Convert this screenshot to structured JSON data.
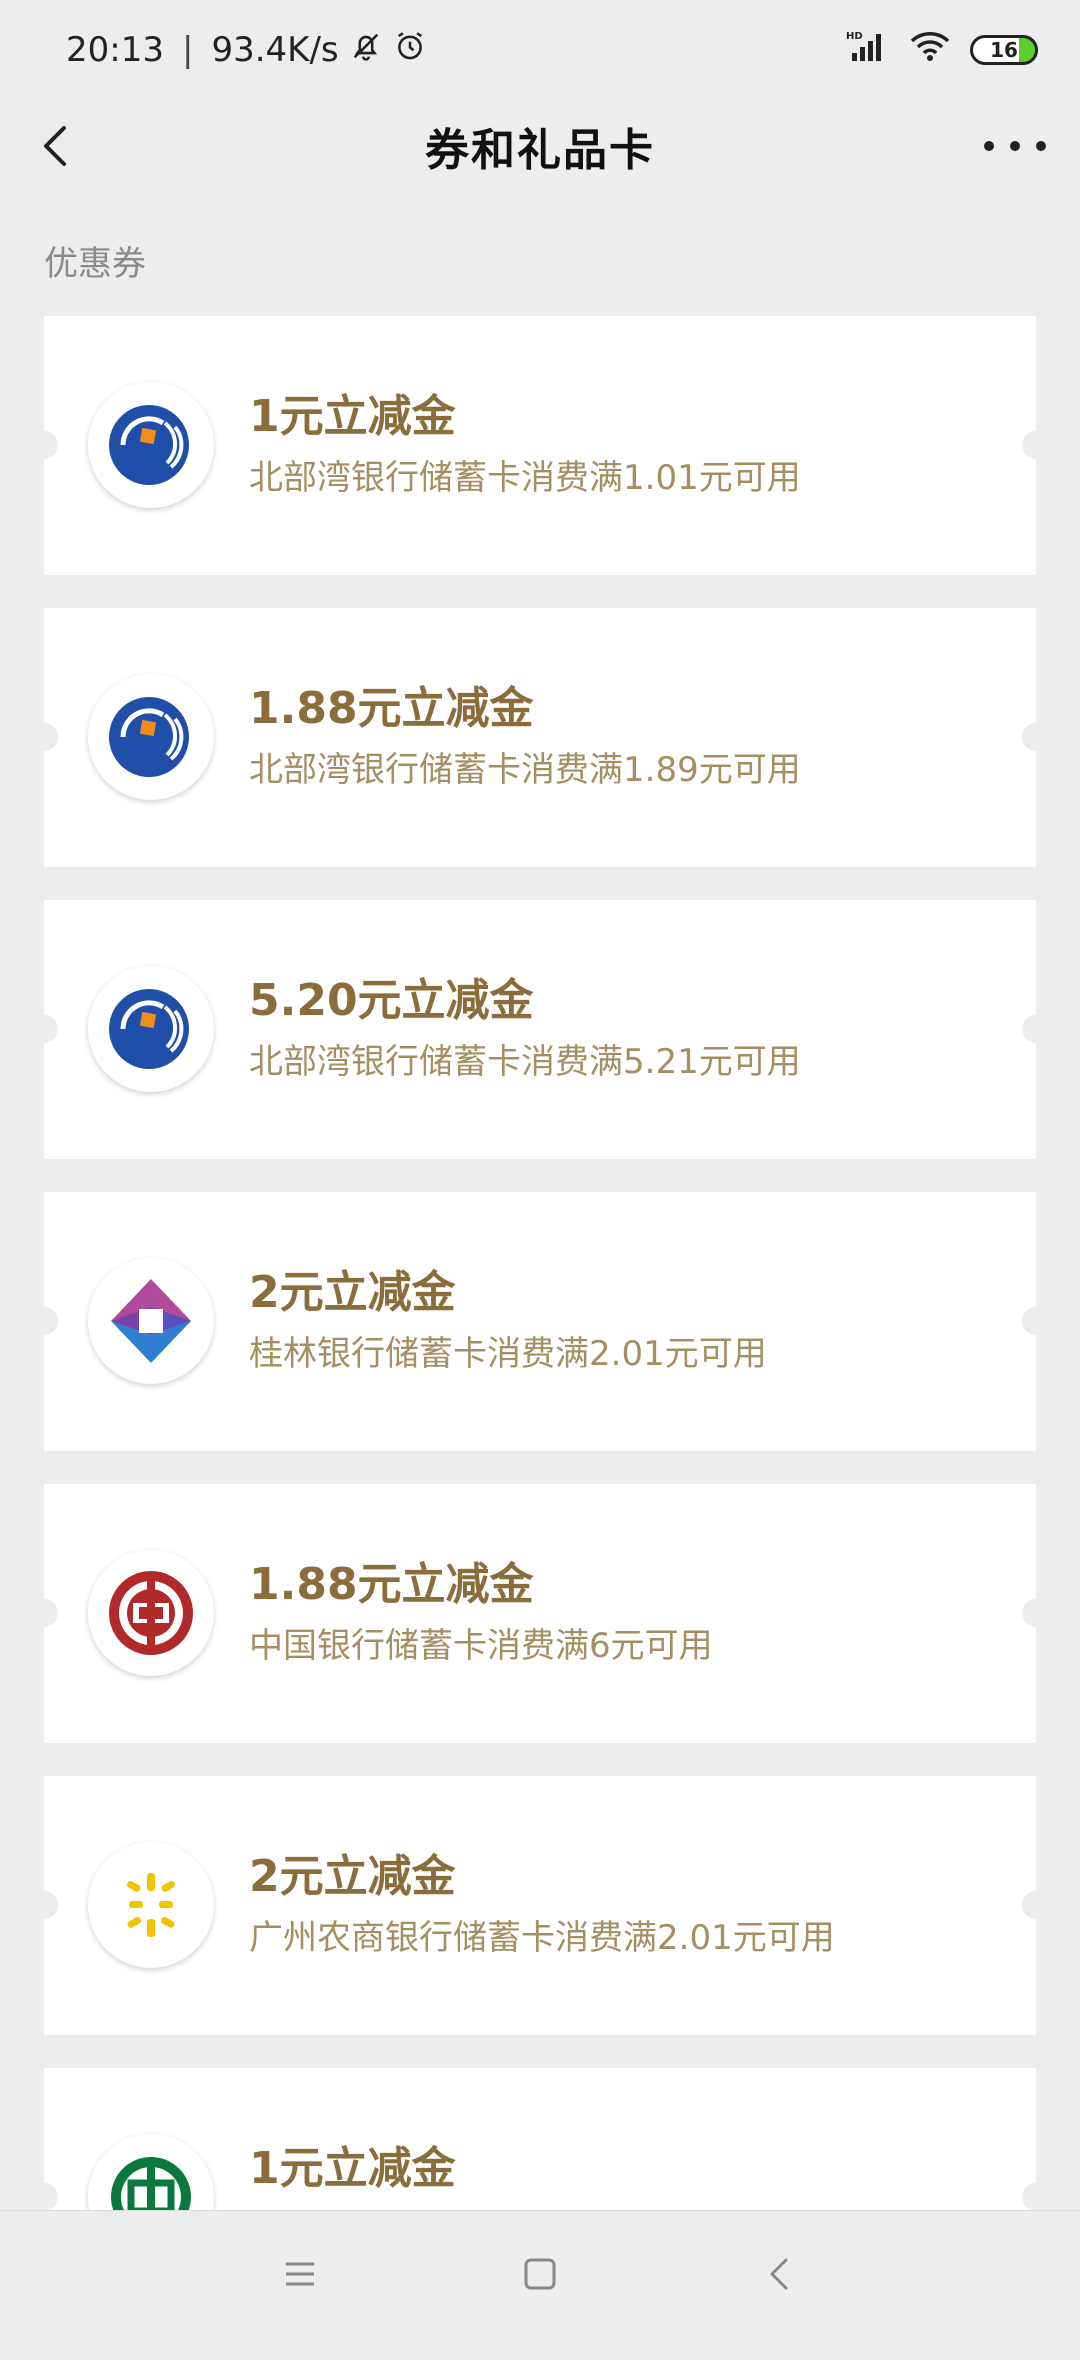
{
  "status": {
    "time": "20:13",
    "speed": "93.4K/s",
    "battery": "16"
  },
  "nav": {
    "title": "券和礼品卡"
  },
  "section_label": "优惠券",
  "coupons": [
    {
      "title": "1元立减金",
      "desc": "北部湾银行储蓄卡消费满1.01元可用",
      "logo": "beibuwan-bank-logo"
    },
    {
      "title": "1.88元立减金",
      "desc": "北部湾银行储蓄卡消费满1.89元可用",
      "logo": "beibuwan-bank-logo"
    },
    {
      "title": "5.20元立减金",
      "desc": "北部湾银行储蓄卡消费满5.21元可用",
      "logo": "beibuwan-bank-logo"
    },
    {
      "title": "2元立减金",
      "desc": "桂林银行储蓄卡消费满2.01元可用",
      "logo": "guilin-bank-logo"
    },
    {
      "title": "1.88元立减金",
      "desc": "中国银行储蓄卡消费满6元可用",
      "logo": "bank-of-china-logo"
    },
    {
      "title": "2元立减金",
      "desc": "广州农商银行储蓄卡消费满2.01元可用",
      "logo": "guangzhou-rural-bank-logo"
    },
    {
      "title": "1元立减金",
      "desc": "",
      "logo": "postal-savings-bank-logo"
    }
  ],
  "colors": {
    "background": "#ededed",
    "card": "#ffffff",
    "coupon_title": "#8a6d3b",
    "coupon_desc": "#a58f62"
  }
}
